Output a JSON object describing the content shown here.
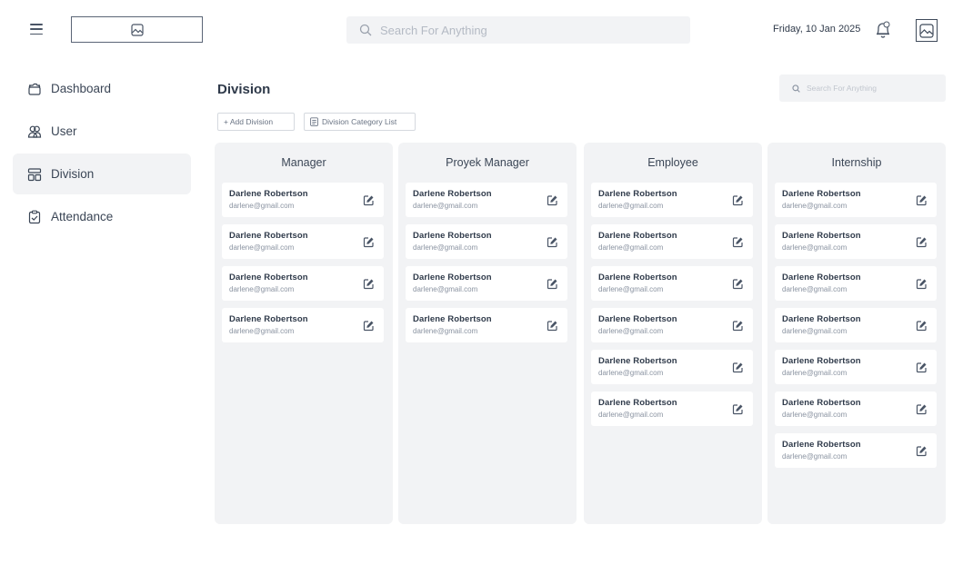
{
  "header": {
    "search_placeholder": "Search For Anything",
    "date": "Friday, 10 Jan 2025",
    "icons": {
      "menu": "hamburger-menu-icon",
      "logo": "image-placeholder-icon",
      "search": "search-icon",
      "notifications": "bell-icon",
      "avatar": "image-placeholder-icon"
    }
  },
  "sidebar": {
    "items": [
      {
        "label": "Dashboard",
        "icon": "folder-icon",
        "active": false
      },
      {
        "label": "User",
        "icon": "users-icon",
        "active": false
      },
      {
        "label": "Division",
        "icon": "grid-icon",
        "active": true
      },
      {
        "label": "Attendance",
        "icon": "clipboard-check-icon",
        "active": false
      }
    ]
  },
  "main": {
    "title": "Division",
    "search_placeholder": "Search For Anything",
    "add_button": "+ Add Division",
    "category_button": "Division Category List",
    "columns": [
      {
        "title": "Manager",
        "cards": [
          {
            "name": "Darlene Robertson",
            "email": "darlene@gmail.com"
          },
          {
            "name": "Darlene Robertson",
            "email": "darlene@gmail.com"
          },
          {
            "name": "Darlene Robertson",
            "email": "darlene@gmail.com"
          },
          {
            "name": "Darlene Robertson",
            "email": "darlene@gmail.com"
          }
        ]
      },
      {
        "title": "Proyek Manager",
        "cards": [
          {
            "name": "Darlene Robertson",
            "email": "darlene@gmail.com"
          },
          {
            "name": "Darlene Robertson",
            "email": "darlene@gmail.com"
          },
          {
            "name": "Darlene Robertson",
            "email": "darlene@gmail.com"
          },
          {
            "name": "Darlene Robertson",
            "email": "darlene@gmail.com"
          }
        ]
      },
      {
        "title": "Employee",
        "cards": [
          {
            "name": "Darlene Robertson",
            "email": "darlene@gmail.com"
          },
          {
            "name": "Darlene Robertson",
            "email": "darlene@gmail.com"
          },
          {
            "name": "Darlene Robertson",
            "email": "darlene@gmail.com"
          },
          {
            "name": "Darlene Robertson",
            "email": "darlene@gmail.com"
          },
          {
            "name": "Darlene Robertson",
            "email": "darlene@gmail.com"
          },
          {
            "name": "Darlene Robertson",
            "email": "darlene@gmail.com"
          }
        ]
      },
      {
        "title": "Internship",
        "cards": [
          {
            "name": "Darlene Robertson",
            "email": "darlene@gmail.com"
          },
          {
            "name": "Darlene Robertson",
            "email": "darlene@gmail.com"
          },
          {
            "name": "Darlene Robertson",
            "email": "darlene@gmail.com"
          },
          {
            "name": "Darlene Robertson",
            "email": "darlene@gmail.com"
          },
          {
            "name": "Darlene Robertson",
            "email": "darlene@gmail.com"
          },
          {
            "name": "Darlene Robertson",
            "email": "darlene@gmail.com"
          },
          {
            "name": "Darlene Robertson",
            "email": "darlene@gmail.com"
          }
        ]
      }
    ]
  },
  "colors": {
    "panel_bg": "#f2f3f5",
    "text_primary": "#2f3a4a",
    "text_muted": "#8a93a1",
    "border": "#d5d9df"
  }
}
